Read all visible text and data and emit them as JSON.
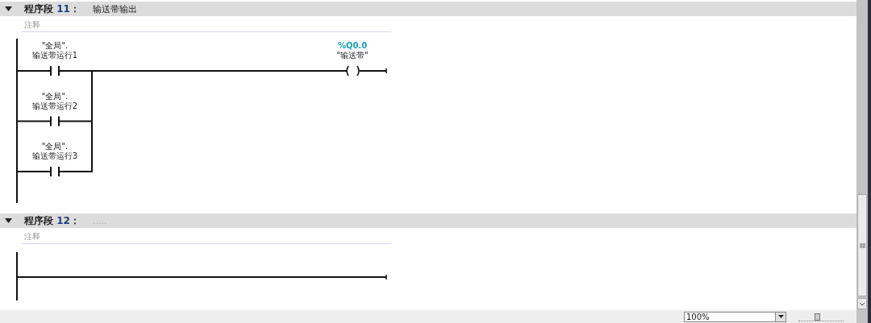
{
  "networks": [
    {
      "expanded": true,
      "label": "程序段",
      "number": "11",
      "separator": "：",
      "name": "输送带输出",
      "comment_placeholder": "注释",
      "contacts": [
        {
          "db": "\"全局\".",
          "tag": "输送带运行1"
        },
        {
          "db": "\"全局\".",
          "tag": "输送带运行2"
        },
        {
          "db": "\"全局\".",
          "tag": "输送带运行3"
        }
      ],
      "coil": {
        "address": "%Q0.0",
        "tag": "\"输送带\""
      }
    },
    {
      "expanded": true,
      "label": "程序段",
      "number": "12",
      "separator": "：",
      "name": ".....",
      "comment_placeholder": "注释"
    }
  ],
  "zoom": {
    "value": "100%",
    "level": 0.4
  }
}
